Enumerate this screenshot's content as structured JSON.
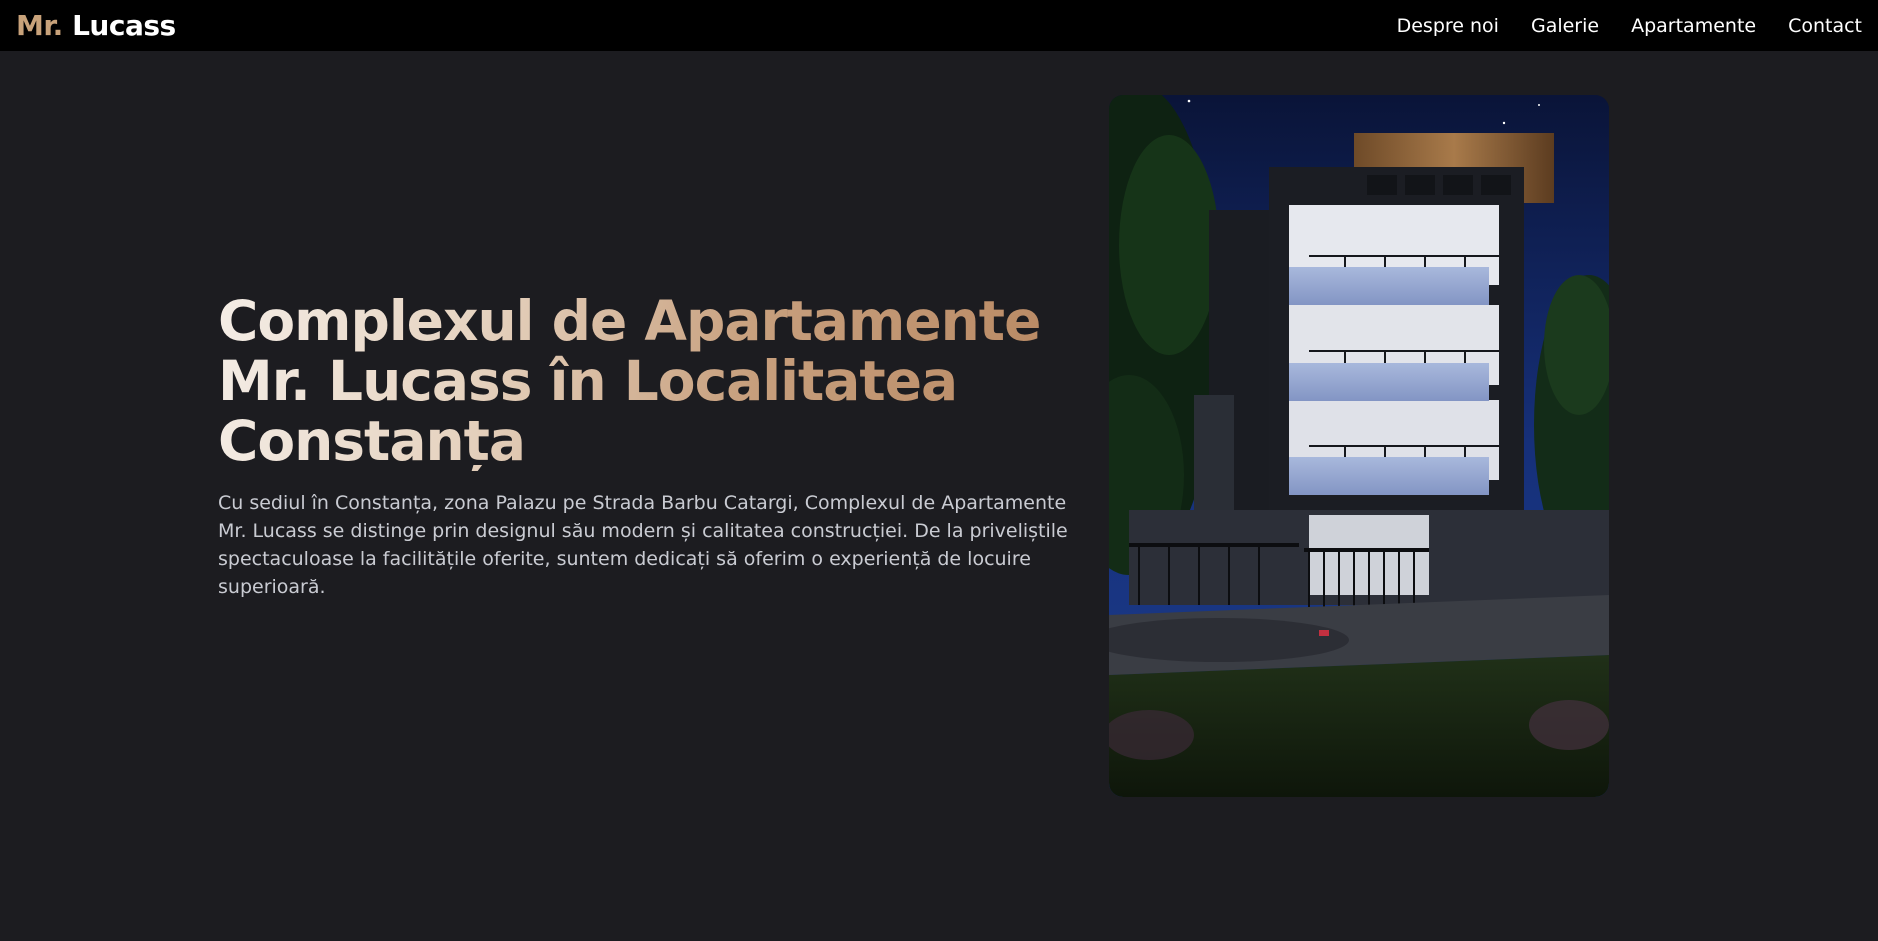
{
  "header": {
    "logo_prefix": "Mr.",
    "logo_name": "Lucass",
    "nav": [
      {
        "label": "Despre noi"
      },
      {
        "label": "Galerie"
      },
      {
        "label": "Apartamente"
      },
      {
        "label": "Contact"
      }
    ]
  },
  "hero": {
    "title": "Complexul de Apartamente Mr. Lucass în Localitatea Constanța",
    "description": "Cu sediul în Constanța, zona Palazu pe Strada Barbu Catargi, Complexul de Apartamente Mr. Lucass se distinge prin designul său modern și calitatea construcției. De la priveliștile spectaculoase la facilitățile oferite, suntem dedicați să oferim o experiență de locuire superioară.",
    "image_icon": "building-photo"
  },
  "colors": {
    "background": "#1c1c20",
    "navbar": "#000000",
    "accent": "#c8a27a",
    "text_light": "#c9cbd2"
  }
}
